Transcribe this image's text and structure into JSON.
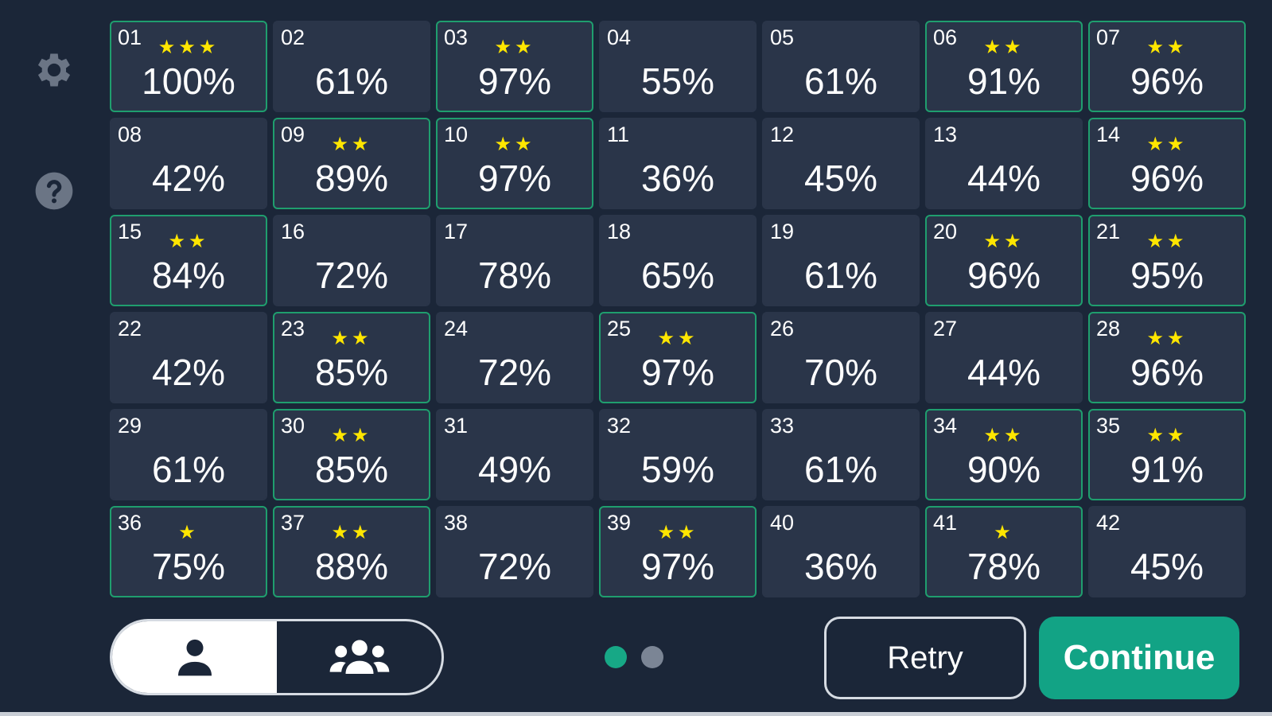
{
  "colors": {
    "background": "#1b2638",
    "tile": "#2a3549",
    "tile_complete_border": "#1f9e6e",
    "star": "#ffe600",
    "accent": "#12a385",
    "dot_inactive": "#7b8595"
  },
  "sidebar": {
    "icons": [
      "gear-icon",
      "help-icon"
    ]
  },
  "levels": [
    {
      "num": "01",
      "stars": "★★★",
      "pct": "100%",
      "done": true
    },
    {
      "num": "02",
      "stars": "",
      "pct": "61%",
      "done": false
    },
    {
      "num": "03",
      "stars": "★★",
      "pct": "97%",
      "done": true
    },
    {
      "num": "04",
      "stars": "",
      "pct": "55%",
      "done": false
    },
    {
      "num": "05",
      "stars": "",
      "pct": "61%",
      "done": false
    },
    {
      "num": "06",
      "stars": "★★",
      "pct": "91%",
      "done": true
    },
    {
      "num": "07",
      "stars": "★★",
      "pct": "96%",
      "done": true
    },
    {
      "num": "08",
      "stars": "",
      "pct": "42%",
      "done": false
    },
    {
      "num": "09",
      "stars": "★★",
      "pct": "89%",
      "done": true
    },
    {
      "num": "10",
      "stars": "★★",
      "pct": "97%",
      "done": true
    },
    {
      "num": "11",
      "stars": "",
      "pct": "36%",
      "done": false
    },
    {
      "num": "12",
      "stars": "",
      "pct": "45%",
      "done": false
    },
    {
      "num": "13",
      "stars": "",
      "pct": "44%",
      "done": false
    },
    {
      "num": "14",
      "stars": "★★",
      "pct": "96%",
      "done": true
    },
    {
      "num": "15",
      "stars": "★★",
      "pct": "84%",
      "done": true
    },
    {
      "num": "16",
      "stars": "",
      "pct": "72%",
      "done": false
    },
    {
      "num": "17",
      "stars": "",
      "pct": "78%",
      "done": false
    },
    {
      "num": "18",
      "stars": "",
      "pct": "65%",
      "done": false
    },
    {
      "num": "19",
      "stars": "",
      "pct": "61%",
      "done": false
    },
    {
      "num": "20",
      "stars": "★★",
      "pct": "96%",
      "done": true
    },
    {
      "num": "21",
      "stars": "★★",
      "pct": "95%",
      "done": true
    },
    {
      "num": "22",
      "stars": "",
      "pct": "42%",
      "done": false
    },
    {
      "num": "23",
      "stars": "★★",
      "pct": "85%",
      "done": true
    },
    {
      "num": "24",
      "stars": "",
      "pct": "72%",
      "done": false
    },
    {
      "num": "25",
      "stars": "★★",
      "pct": "97%",
      "done": true
    },
    {
      "num": "26",
      "stars": "",
      "pct": "70%",
      "done": false
    },
    {
      "num": "27",
      "stars": "",
      "pct": "44%",
      "done": false
    },
    {
      "num": "28",
      "stars": "★★",
      "pct": "96%",
      "done": true
    },
    {
      "num": "29",
      "stars": "",
      "pct": "61%",
      "done": false
    },
    {
      "num": "30",
      "stars": "★★",
      "pct": "85%",
      "done": true
    },
    {
      "num": "31",
      "stars": "",
      "pct": "49%",
      "done": false
    },
    {
      "num": "32",
      "stars": "",
      "pct": "59%",
      "done": false
    },
    {
      "num": "33",
      "stars": "",
      "pct": "61%",
      "done": false
    },
    {
      "num": "34",
      "stars": "★★",
      "pct": "90%",
      "done": true
    },
    {
      "num": "35",
      "stars": "★★",
      "pct": "91%",
      "done": true
    },
    {
      "num": "36",
      "stars": "★",
      "pct": "75%",
      "done": true
    },
    {
      "num": "37",
      "stars": "★★",
      "pct": "88%",
      "done": true
    },
    {
      "num": "38",
      "stars": "",
      "pct": "72%",
      "done": false
    },
    {
      "num": "39",
      "stars": "★★",
      "pct": "97%",
      "done": true
    },
    {
      "num": "40",
      "stars": "",
      "pct": "36%",
      "done": false
    },
    {
      "num": "41",
      "stars": "★",
      "pct": "78%",
      "done": true
    },
    {
      "num": "42",
      "stars": "",
      "pct": "45%",
      "done": false
    }
  ],
  "mode_toggle": {
    "options": [
      "person-icon",
      "group-icon"
    ],
    "selected": "person-icon"
  },
  "pagination": {
    "current_page": 1,
    "total_pages": 2
  },
  "buttons": {
    "retry_label": "Retry",
    "continue_label": "Continue"
  }
}
